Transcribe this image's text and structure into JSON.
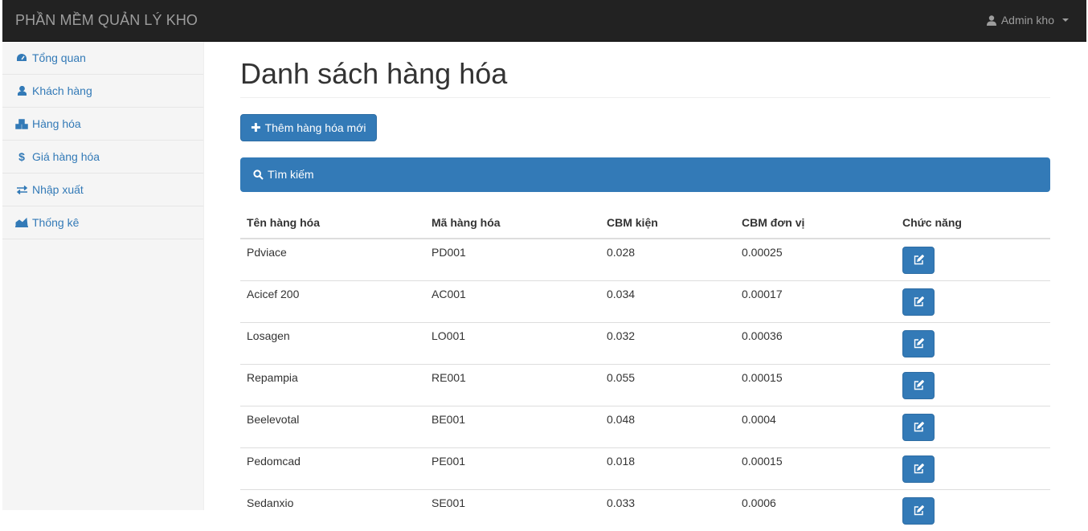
{
  "navbar": {
    "brand": "PHẦN MỀM QUẢN LÝ KHO",
    "user_label": "Admin kho"
  },
  "sidebar": {
    "items": [
      {
        "label": "Tổng quan",
        "icon": "dashboard-icon"
      },
      {
        "label": "Khách hàng",
        "icon": "user-icon"
      },
      {
        "label": "Hàng hóa",
        "icon": "cubes-icon"
      },
      {
        "label": "Giá hàng hóa",
        "icon": "dollar-icon"
      },
      {
        "label": "Nhập xuất",
        "icon": "exchange-icon"
      },
      {
        "label": "Thống kê",
        "icon": "area-chart-icon"
      }
    ]
  },
  "main": {
    "title": "Danh sách hàng hóa",
    "add_button": "Thêm hàng hóa mới",
    "search_panel": "Tìm kiếm",
    "table": {
      "headers": [
        "Tên hàng hóa",
        "Mã hàng hóa",
        "CBM kiện",
        "CBM đơn vị",
        "Chức năng"
      ],
      "rows": [
        [
          "Pdviace",
          "PD001",
          "0.028",
          "0.00025"
        ],
        [
          "Acicef 200",
          "AC001",
          "0.034",
          "0.00017"
        ],
        [
          "Losagen",
          "LO001",
          "0.032",
          "0.00036"
        ],
        [
          "Repampia",
          "RE001",
          "0.055",
          "0.00015"
        ],
        [
          "Beelevotal",
          "BE001",
          "0.048",
          "0.0004"
        ],
        [
          "Pedomcad",
          "PE001",
          "0.018",
          "0.00015"
        ],
        [
          "Sedanxio",
          "SE001",
          "0.033",
          "0.0006"
        ]
      ]
    }
  },
  "colors": {
    "navbar_bg": "#222222",
    "primary": "#337ab7",
    "sidebar_bg": "#f5f5f5"
  }
}
